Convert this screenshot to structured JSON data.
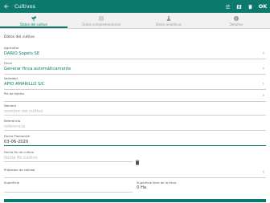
{
  "appbar": {
    "title": "Cultivos",
    "ok_label": "OK"
  },
  "tabs": [
    {
      "label": "Datos del cultivo"
    },
    {
      "label": "Datos complementarios"
    },
    {
      "label": "Datos analíticos"
    },
    {
      "label": "Detalles"
    }
  ],
  "form": {
    "section_title": "Datos del cultivo",
    "agricultor": {
      "label": "Agricultor",
      "value": "DARIO Sopelo SE"
    },
    "finca": {
      "label": "Finca",
      "value": "Generar finca automáticamente"
    },
    "variedad": {
      "label": "Variedad",
      "value": "APIO AMARILLO S/C"
    },
    "pie_injerto": {
      "label": "Pie de injerto",
      "value": ""
    },
    "nombre": {
      "label": "Nombre",
      "placeholder": "nombre del cultivo"
    },
    "referencia": {
      "label": "Referencia",
      "placeholder": "referencia"
    },
    "fecha_plantacion": {
      "label": "Fecha Plantación",
      "value": "03-06-2020"
    },
    "fecha_fin": {
      "label": "Fecha fin de cultivo",
      "placeholder": "fecha fin cultivo"
    },
    "protocolo": {
      "label": "Protocolo de calidad",
      "value": ""
    },
    "superficie": {
      "label": "Superficie",
      "value": ""
    },
    "superficie_finca": {
      "label": "Superficie libre de la finca",
      "value": "0 Ha"
    }
  }
}
